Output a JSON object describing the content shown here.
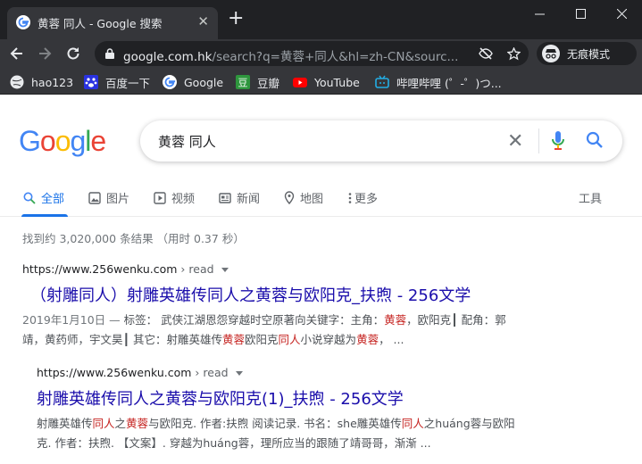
{
  "browser": {
    "tab_title": "黄蓉 同人 - Google 搜索",
    "url_host": "google.com.hk",
    "url_path": "/search?q=黄蓉+同人&hl=zh-CN&sourc...",
    "incognito_label": "无痕模式",
    "bookmarks": [
      {
        "label": "hao123"
      },
      {
        "label": "百度一下"
      },
      {
        "label": "Google"
      },
      {
        "label": "豆瓣"
      },
      {
        "label": "YouTube"
      },
      {
        "label": "哔哩哔哩 (゜-゜)つ..."
      }
    ]
  },
  "search": {
    "logo": [
      "G",
      "o",
      "o",
      "g",
      "l",
      "e"
    ],
    "logo_colors": [
      "#4285f4",
      "#ea4335",
      "#fbbc05",
      "#4285f4",
      "#34a853",
      "#ea4335"
    ],
    "query": "黄蓉 同人",
    "tabs": [
      "全部",
      "图片",
      "视频",
      "新闻",
      "地图",
      "更多"
    ],
    "tools": "工具",
    "stats": "找到约 3,020,000 条结果 （用时 0.37 秒）"
  },
  "results": [
    {
      "cite_host": "https://www.256wenku.com",
      "cite_path": " › read",
      "title": "（射雕同人）射雕英雄传同人之黄蓉与欧阳克_扶煦 - 256文学",
      "date": "2019年1月10日 — ",
      "snippet_line1": [
        "标签： 武侠江湖恩怨穿越时空原著向关键字：主角：",
        "黄蓉",
        "，欧阳克┃ 配角：郭"
      ],
      "snippet_line2": [
        "靖，黄药师，宇文昊┃ 其它：射雕英雄传",
        "黄蓉",
        "欧阳克",
        "同人",
        "小说穿越为",
        "黄蓉",
        "， ..."
      ]
    },
    {
      "cite_host": "https://www.256wenku.com",
      "cite_path": " › read",
      "title": "射雕英雄传同人之黄蓉与欧阳克(1)_扶煦 - 256文学",
      "snippet_line1": [
        "射雕英雄传",
        "同人",
        "之",
        "黄蓉",
        "与欧阳克. 作者:扶煦 阅读记录. 书名：she雕英雄传",
        "同人",
        "之huáng蓉与欧阳"
      ],
      "snippet_line2": [
        "克. 作者：扶煦. 【文案】. 穿越为huáng蓉，理所应当的跟随了靖哥哥，渐渐 ..."
      ]
    }
  ]
}
